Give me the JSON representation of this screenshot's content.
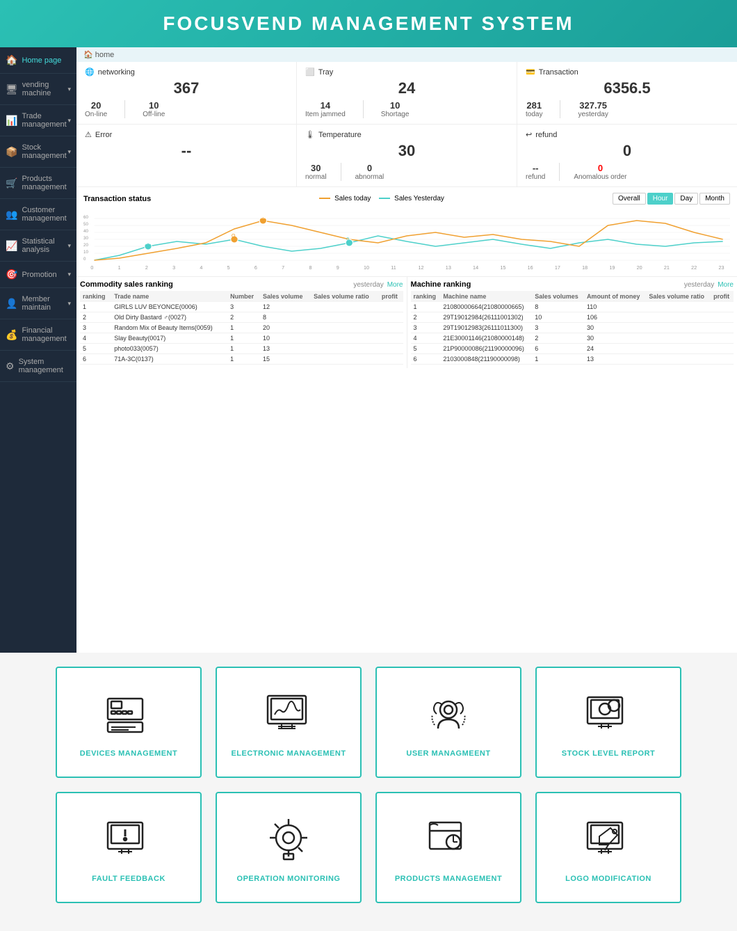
{
  "header": {
    "title": "FOCUSVEND MANAGEMENT SYSTEM"
  },
  "breadcrumb": "home",
  "sidebar": {
    "items": [
      {
        "label": "Home page",
        "icon": "🏠",
        "active": true,
        "arrow": false
      },
      {
        "label": "vending machine",
        "icon": "🖥",
        "active": false,
        "arrow": true
      },
      {
        "label": "Trade management",
        "icon": "📊",
        "active": false,
        "arrow": true
      },
      {
        "label": "Stock management",
        "icon": "📦",
        "active": false,
        "arrow": true
      },
      {
        "label": "Products management",
        "icon": "🛒",
        "active": false,
        "arrow": false
      },
      {
        "label": "Customer management",
        "icon": "👥",
        "active": false,
        "arrow": false
      },
      {
        "label": "Statistical analysis",
        "icon": "📈",
        "active": false,
        "arrow": true
      },
      {
        "label": "Promotion",
        "icon": "🎯",
        "active": false,
        "arrow": true
      },
      {
        "label": "Member maintain",
        "icon": "👤",
        "active": false,
        "arrow": true
      },
      {
        "label": "Financial management",
        "icon": "💰",
        "active": false,
        "arrow": false
      },
      {
        "label": "System management",
        "icon": "⚙",
        "active": false,
        "arrow": false
      }
    ]
  },
  "stats": {
    "networking": {
      "title": "networking",
      "total": "367",
      "online_label": "On-line",
      "online_val": "20",
      "offline_label": "Off-line",
      "offline_val": "10"
    },
    "tray": {
      "title": "Tray",
      "total": "24",
      "jammed_label": "Item jammed",
      "jammed_val": "14",
      "shortage_label": "Shortage",
      "shortage_val": "10"
    },
    "transaction": {
      "title": "Transaction",
      "total": "6356.5",
      "today_label": "today",
      "today_val": "281",
      "yesterday_label": "yesterday",
      "yesterday_val": "327.75"
    }
  },
  "stats2": {
    "error": {
      "title": "Error",
      "total": "--"
    },
    "temperature": {
      "title": "Temperature",
      "total": "30",
      "normal_label": "normal",
      "normal_val": "30",
      "abnormal_label": "abnormal",
      "abnormal_val": "0"
    },
    "refund": {
      "title": "refund",
      "total": "0",
      "refund_label": "refund",
      "refund_val": "--",
      "anomalous_label": "Anomalous order",
      "anomalous_val": "0"
    }
  },
  "chart": {
    "title": "Transaction status",
    "legend_today": "Sales today",
    "legend_yesterday": "Sales Yesterday",
    "buttons": [
      "Overall",
      "Hour",
      "Day",
      "Month"
    ],
    "active_button": "Hour"
  },
  "commodity_table": {
    "title": "Commodity sales ranking",
    "yesterday_label": "yesterday",
    "more_label": "More",
    "columns": [
      "ranking",
      "Trade name",
      "Number",
      "Sales volume",
      "Sales volume ratio",
      "profit"
    ],
    "rows": [
      [
        "1",
        "GIRLS LUV BEYONCE(0006)",
        "3",
        "12",
        "",
        ""
      ],
      [
        "2",
        "Old Dirty Bastard ♂(0027)",
        "2",
        "8",
        "",
        ""
      ],
      [
        "3",
        "Random Mix of Beauty Items(0059)",
        "1",
        "20",
        "",
        ""
      ],
      [
        "4",
        "Slay Beauty(0017)",
        "1",
        "10",
        "",
        ""
      ],
      [
        "5",
        "photo033(0057)",
        "1",
        "13",
        "",
        ""
      ],
      [
        "6",
        "71A-3C(0137)",
        "1",
        "15",
        "",
        ""
      ]
    ]
  },
  "machine_table": {
    "title": "Machine ranking",
    "yesterday_label": "yesterday",
    "more_label": "More",
    "columns": [
      "ranking",
      "Machine name",
      "Sales volumes",
      "Amount of money",
      "Sales volume ratio",
      "profit"
    ],
    "rows": [
      [
        "1",
        "21080000664(21080000665)",
        "8",
        "110",
        "",
        ""
      ],
      [
        "2",
        "29T19012984(26111001302)",
        "10",
        "106",
        "",
        ""
      ],
      [
        "3",
        "29T19012983(26111011300)",
        "3",
        "30",
        "",
        ""
      ],
      [
        "4",
        "21E30001146(21080000148)",
        "2",
        "30",
        "",
        ""
      ],
      [
        "5",
        "21P90000086(21190000096)",
        "6",
        "24",
        "",
        ""
      ],
      [
        "6",
        "2103000848(21190000098)",
        "1",
        "13",
        "",
        ""
      ]
    ]
  },
  "cards": {
    "row1": [
      {
        "label": "DEVICES MANAGEMENT",
        "icon": "devices"
      },
      {
        "label": "ELECTRONIC MANAGEMENT",
        "icon": "electronic"
      },
      {
        "label": "USER MANAGMEENT",
        "icon": "user"
      },
      {
        "label": "STOCK LEVEL REPORT",
        "icon": "stock"
      }
    ],
    "row2": [
      {
        "label": "FAULT FEEDBACK",
        "icon": "fault"
      },
      {
        "label": "OPERATION MONITORING",
        "icon": "operation"
      },
      {
        "label": "PRODUCTS MANAGEMENT",
        "icon": "products"
      },
      {
        "label": "LOGO MODIFICATION",
        "icon": "logo"
      }
    ]
  }
}
